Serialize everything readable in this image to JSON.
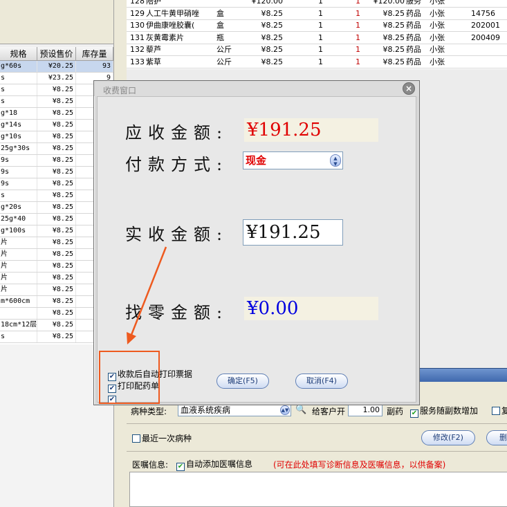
{
  "left_table": {
    "headers": [
      "规格",
      "预设售价",
      "库存量"
    ],
    "rows": [
      {
        "spec": "g*60s",
        "price": "¥20.25",
        "stock": "93",
        "selected": true
      },
      {
        "spec": "s",
        "price": "¥23.25",
        "stock": "9"
      },
      {
        "spec": "s",
        "price": "¥8.25",
        "stock": ""
      },
      {
        "spec": "s",
        "price": "¥8.25",
        "stock": ""
      },
      {
        "spec": "g*18",
        "price": "¥8.25",
        "stock": ""
      },
      {
        "spec": "g*14s",
        "price": "¥8.25",
        "stock": ""
      },
      {
        "spec": "g*10s",
        "price": "¥8.25",
        "stock": ""
      },
      {
        "spec": "25g*30s",
        "price": "¥8.25",
        "stock": ""
      },
      {
        "spec": "9s",
        "price": "¥8.25",
        "stock": ""
      },
      {
        "spec": "9s",
        "price": "¥8.25",
        "stock": ""
      },
      {
        "spec": "9s",
        "price": "¥8.25",
        "stock": ""
      },
      {
        "spec": "s",
        "price": "¥8.25",
        "stock": ""
      },
      {
        "spec": "g*20s",
        "price": "¥8.25",
        "stock": ""
      },
      {
        "spec": "25g*40",
        "price": "¥8.25",
        "stock": ""
      },
      {
        "spec": "g*100s",
        "price": "¥8.25",
        "stock": ""
      },
      {
        "spec": "片",
        "price": "¥8.25",
        "stock": ""
      },
      {
        "spec": "片",
        "price": "¥8.25",
        "stock": ""
      },
      {
        "spec": "片",
        "price": "¥8.25",
        "stock": ""
      },
      {
        "spec": "片",
        "price": "¥8.25",
        "stock": ""
      },
      {
        "spec": "片",
        "price": "¥8.25",
        "stock": ""
      },
      {
        "spec": "m*600cm",
        "price": "¥8.25",
        "stock": ""
      },
      {
        "spec": "",
        "price": "¥8.25",
        "stock": ""
      },
      {
        "spec": "18cm*12层",
        "price": "¥8.25",
        "stock": ""
      },
      {
        "spec": "s",
        "price": "¥8.25",
        "stock": ""
      }
    ]
  },
  "right_table": {
    "rows": [
      {
        "no": "128",
        "name": "陪护",
        "unit": "",
        "price": "¥120.00",
        "qty": "1",
        "qty2": "1",
        "amount": "¥120.00",
        "category": "服务",
        "person": "小张",
        "code": ""
      },
      {
        "no": "129",
        "name": "人工牛黄甲硝唑",
        "unit": "盒",
        "price": "¥8.25",
        "qty": "1",
        "qty2": "1",
        "amount": "¥8.25",
        "category": "药品",
        "person": "小张",
        "code": "14756"
      },
      {
        "no": "130",
        "name": "伊曲康唑胶囊(",
        "unit": "盒",
        "price": "¥8.25",
        "qty": "1",
        "qty2": "1",
        "amount": "¥8.25",
        "category": "药品",
        "person": "小张",
        "code": "202001"
      },
      {
        "no": "131",
        "name": "灰黄霉素片",
        "unit": "瓶",
        "price": "¥8.25",
        "qty": "1",
        "qty2": "1",
        "amount": "¥8.25",
        "category": "药品",
        "person": "小张",
        "code": "200409"
      },
      {
        "no": "132",
        "name": "藜芦",
        "unit": "公斤",
        "price": "¥8.25",
        "qty": "1",
        "qty2": "1",
        "amount": "¥8.25",
        "category": "药品",
        "person": "小张",
        "code": ""
      },
      {
        "no": "133",
        "name": "紫草",
        "unit": "公斤",
        "price": "¥8.25",
        "qty": "1",
        "qty2": "1",
        "amount": "¥8.25",
        "category": "药品",
        "person": "小张",
        "code": ""
      }
    ]
  },
  "form": {
    "disease_type_label": "病种类型:",
    "disease_type_value": "血液系统疾病",
    "give_client_label": "给客户开",
    "give_client_value": "1.00",
    "dose_unit": "副药",
    "service_follow_label": "服务随副数增加",
    "service_follow_checked": true,
    "extra_checkbox_label": "复",
    "recent_disease_label": "最近一次病种",
    "recent_disease_checked": false,
    "modify_button": "修改(F2)",
    "delete_button": "删除",
    "advice_label": "医嘱信息:",
    "auto_add_advice_label": "自动添加医嘱信息",
    "auto_add_advice_checked": true,
    "advice_hint": "(可在此处填写诊断信息及医嘱信息，以供备案)"
  },
  "dialog": {
    "title": "收费窗口",
    "due_label": "应收金额:",
    "due_value": "¥191.25",
    "pay_method_label": "付款方式:",
    "pay_method_value": "现金",
    "paid_label": "实收金额:",
    "paid_value": "¥191.25",
    "change_label": "找零金额:",
    "change_value": "¥0.00",
    "checkboxes": [
      {
        "label": "收款后自动打印票据",
        "checked": true
      },
      {
        "label": "打印配药单",
        "checked": true
      },
      {
        "label": "",
        "checked": true
      }
    ],
    "confirm_button": "确定(F5)",
    "cancel_button": "取消(F4)"
  },
  "colors": {
    "due_red": "#e00000",
    "change_blue": "#0000e0",
    "highlight_orange": "#ee5a1f",
    "tab_blue": "#3f68ad"
  }
}
